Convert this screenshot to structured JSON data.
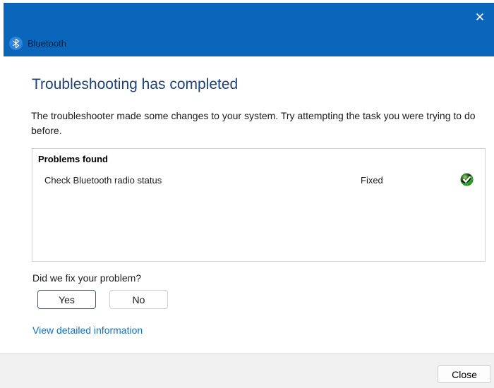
{
  "colors": {
    "accent": "#0a66bb",
    "accent_dark": "#0d5aa3",
    "title_blue": "#1d4179",
    "link_blue": "#1170bd",
    "success_green": "#18a018",
    "footer_gray": "#f0f0f0",
    "border_gray": "#d0d0d0",
    "text_dark": "#1b1b1b",
    "header_text": "#0b1e33"
  },
  "window": {
    "close_glyph": "✕"
  },
  "header": {
    "app_name": "Bluetooth",
    "icon": "bluetooth-icon"
  },
  "main": {
    "title": "Troubleshooting has completed",
    "description": "The troubleshooter made some changes to your system. Try attempting the task you were trying to do before.",
    "results": {
      "header": "Problems found",
      "rows": [
        {
          "name": "Check Bluetooth radio status",
          "status": "Fixed",
          "icon": "fixed-check-icon"
        }
      ]
    },
    "question": "Did we fix your problem?",
    "yes_label": "Yes",
    "no_label": "No",
    "detail_link": "View detailed information"
  },
  "footer": {
    "close_label": "Close"
  }
}
